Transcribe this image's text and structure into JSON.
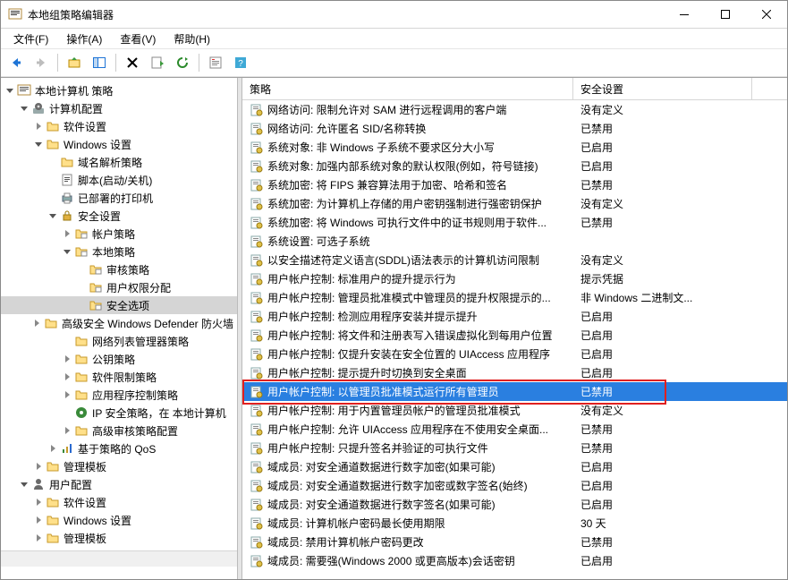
{
  "window": {
    "title": "本地组策略编辑器"
  },
  "menubar": [
    "文件(F)",
    "操作(A)",
    "查看(V)",
    "帮助(H)"
  ],
  "cols": {
    "policy": "策略",
    "setting": "安全设置"
  },
  "col_widths": {
    "c1": 370,
    "c2": 200
  },
  "tree": [
    {
      "depth": 0,
      "exp": "open",
      "icon": "mmc",
      "label": "本地计算机 策略",
      "sel": false
    },
    {
      "depth": 1,
      "exp": "open",
      "icon": "gear",
      "label": "计算机配置",
      "sel": false
    },
    {
      "depth": 2,
      "exp": "closed",
      "icon": "folder",
      "label": "软件设置",
      "sel": false
    },
    {
      "depth": 2,
      "exp": "open",
      "icon": "folder",
      "label": "Windows 设置",
      "sel": false
    },
    {
      "depth": 3,
      "exp": "none",
      "icon": "folder",
      "label": "域名解析策略",
      "sel": false
    },
    {
      "depth": 3,
      "exp": "none",
      "icon": "script",
      "label": "脚本(启动/关机)",
      "sel": false
    },
    {
      "depth": 3,
      "exp": "none",
      "icon": "printer",
      "label": "已部署的打印机",
      "sel": false
    },
    {
      "depth": 3,
      "exp": "open",
      "icon": "lock",
      "label": "安全设置",
      "sel": false
    },
    {
      "depth": 4,
      "exp": "closed",
      "icon": "folder2",
      "label": "帐户策略",
      "sel": false
    },
    {
      "depth": 4,
      "exp": "open",
      "icon": "folder2",
      "label": "本地策略",
      "sel": false
    },
    {
      "depth": 5,
      "exp": "none",
      "icon": "folder2",
      "label": "审核策略",
      "sel": false
    },
    {
      "depth": 5,
      "exp": "none",
      "icon": "folder2",
      "label": "用户权限分配",
      "sel": false
    },
    {
      "depth": 5,
      "exp": "none",
      "icon": "folder2",
      "label": "安全选项",
      "sel": true
    },
    {
      "depth": 4,
      "exp": "closed",
      "icon": "folder",
      "label": "高级安全 Windows Defender 防火墙",
      "sel": false
    },
    {
      "depth": 4,
      "exp": "none",
      "icon": "folder",
      "label": "网络列表管理器策略",
      "sel": false
    },
    {
      "depth": 4,
      "exp": "closed",
      "icon": "folder",
      "label": "公钥策略",
      "sel": false
    },
    {
      "depth": 4,
      "exp": "closed",
      "icon": "folder",
      "label": "软件限制策略",
      "sel": false
    },
    {
      "depth": 4,
      "exp": "closed",
      "icon": "folder",
      "label": "应用程序控制策略",
      "sel": false
    },
    {
      "depth": 4,
      "exp": "none",
      "icon": "ipsec",
      "label": "IP 安全策略，在 本地计算机",
      "sel": false
    },
    {
      "depth": 4,
      "exp": "closed",
      "icon": "folder",
      "label": "高级审核策略配置",
      "sel": false
    },
    {
      "depth": 3,
      "exp": "closed",
      "icon": "qos",
      "label": "基于策略的 QoS",
      "sel": false
    },
    {
      "depth": 2,
      "exp": "closed",
      "icon": "folder",
      "label": "管理模板",
      "sel": false
    },
    {
      "depth": 1,
      "exp": "open",
      "icon": "user",
      "label": "用户配置",
      "sel": false
    },
    {
      "depth": 2,
      "exp": "closed",
      "icon": "folder",
      "label": "软件设置",
      "sel": false
    },
    {
      "depth": 2,
      "exp": "closed",
      "icon": "folder",
      "label": "Windows 设置",
      "sel": false
    },
    {
      "depth": 2,
      "exp": "closed",
      "icon": "folder",
      "label": "管理模板",
      "sel": false
    }
  ],
  "rows": [
    {
      "name": "网络访问: 限制允许对 SAM 进行远程调用的客户端",
      "val": "没有定义",
      "sel": false
    },
    {
      "name": "网络访问: 允许匿名 SID/名称转换",
      "val": "已禁用",
      "sel": false
    },
    {
      "name": "系统对象: 非 Windows 子系统不要求区分大小写",
      "val": "已启用",
      "sel": false
    },
    {
      "name": "系统对象: 加强内部系统对象的默认权限(例如，符号链接)",
      "val": "已启用",
      "sel": false
    },
    {
      "name": "系统加密: 将 FIPS 兼容算法用于加密、哈希和签名",
      "val": "已禁用",
      "sel": false
    },
    {
      "name": "系统加密: 为计算机上存储的用户密钥强制进行强密钥保护",
      "val": "没有定义",
      "sel": false
    },
    {
      "name": "系统加密: 将 Windows 可执行文件中的证书规则用于软件...",
      "val": "已禁用",
      "sel": false
    },
    {
      "name": "系统设置: 可选子系统",
      "val": "",
      "sel": false
    },
    {
      "name": "以安全描述符定义语言(SDDL)语法表示的计算机访问限制",
      "val": "没有定义",
      "sel": false
    },
    {
      "name": "用户帐户控制: 标准用户的提升提示行为",
      "val": "提示凭据",
      "sel": false
    },
    {
      "name": "用户帐户控制: 管理员批准模式中管理员的提升权限提示的...",
      "val": "非 Windows 二进制文...",
      "sel": false
    },
    {
      "name": "用户帐户控制: 检测应用程序安装并提示提升",
      "val": "已启用",
      "sel": false
    },
    {
      "name": "用户帐户控制: 将文件和注册表写入错误虚拟化到每用户位置",
      "val": "已启用",
      "sel": false
    },
    {
      "name": "用户帐户控制: 仅提升安装在安全位置的 UIAccess 应用程序",
      "val": "已启用",
      "sel": false
    },
    {
      "name": "用户帐户控制: 提示提升时切换到安全桌面",
      "val": "已启用",
      "sel": false
    },
    {
      "name": "用户帐户控制: 以管理员批准模式运行所有管理员",
      "val": "已禁用",
      "sel": true
    },
    {
      "name": "用户帐户控制: 用于内置管理员帐户的管理员批准模式",
      "val": "没有定义",
      "sel": false
    },
    {
      "name": "用户帐户控制: 允许 UIAccess 应用程序在不使用安全桌面...",
      "val": "已禁用",
      "sel": false
    },
    {
      "name": "用户帐户控制: 只提升签名并验证的可执行文件",
      "val": "已禁用",
      "sel": false
    },
    {
      "name": "域成员: 对安全通道数据进行数字加密(如果可能)",
      "val": "已启用",
      "sel": false
    },
    {
      "name": "域成员: 对安全通道数据进行数字加密或数字签名(始终)",
      "val": "已启用",
      "sel": false
    },
    {
      "name": "域成员: 对安全通道数据进行数字签名(如果可能)",
      "val": "已启用",
      "sel": false
    },
    {
      "name": "域成员: 计算机帐户密码最长使用期限",
      "val": "30 天",
      "sel": false
    },
    {
      "name": "域成员: 禁用计算机帐户密码更改",
      "val": "已禁用",
      "sel": false
    },
    {
      "name": "域成员: 需要强(Windows 2000 或更高版本)会话密钥",
      "val": "已启用",
      "sel": false
    }
  ]
}
